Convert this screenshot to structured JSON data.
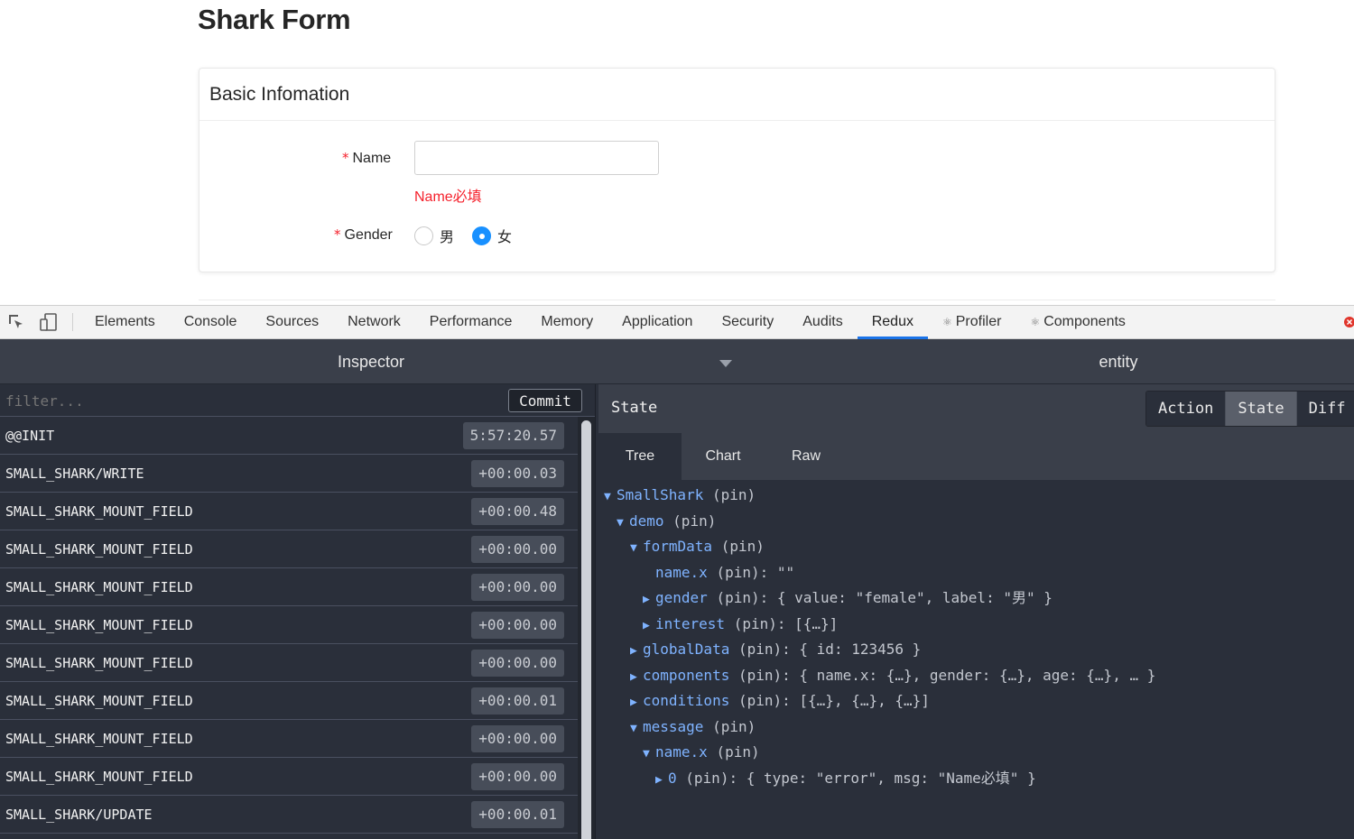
{
  "page": {
    "title": "Shark Form",
    "card_title": "Basic Infomation",
    "name_label": "Name",
    "name_value": "",
    "name_error": "Name必填",
    "gender_label": "Gender",
    "required_mark": "*",
    "gender_options": [
      "男",
      "女"
    ],
    "gender_selected": "女"
  },
  "devtools": {
    "tabs": [
      "Elements",
      "Console",
      "Sources",
      "Network",
      "Performance",
      "Memory",
      "Application",
      "Security",
      "Audits",
      "Redux",
      "Profiler",
      "Components"
    ],
    "active_tab": "Redux",
    "accent_color": "#1a73e8"
  },
  "redux": {
    "inspector_title": "Inspector",
    "entity_title": "entity",
    "filter_placeholder": "filter...",
    "commit_label": "Commit",
    "actions": [
      {
        "name": "@@INIT",
        "time": "5:57:20.57"
      },
      {
        "name": "SMALL_SHARK/WRITE",
        "time": "+00:00.03"
      },
      {
        "name": "SMALL_SHARK_MOUNT_FIELD",
        "time": "+00:00.48"
      },
      {
        "name": "SMALL_SHARK_MOUNT_FIELD",
        "time": "+00:00.00"
      },
      {
        "name": "SMALL_SHARK_MOUNT_FIELD",
        "time": "+00:00.00"
      },
      {
        "name": "SMALL_SHARK_MOUNT_FIELD",
        "time": "+00:00.00"
      },
      {
        "name": "SMALL_SHARK_MOUNT_FIELD",
        "time": "+00:00.00"
      },
      {
        "name": "SMALL_SHARK_MOUNT_FIELD",
        "time": "+00:00.01"
      },
      {
        "name": "SMALL_SHARK_MOUNT_FIELD",
        "time": "+00:00.00"
      },
      {
        "name": "SMALL_SHARK_MOUNT_FIELD",
        "time": "+00:00.00"
      },
      {
        "name": "SMALL_SHARK/UPDATE",
        "time": "+00:00.01"
      }
    ],
    "state_label": "State",
    "modes": [
      "Action",
      "State",
      "Diff"
    ],
    "active_mode": "State",
    "subtabs": [
      "Tree",
      "Chart",
      "Raw"
    ],
    "active_subtab": "Tree",
    "tree": [
      {
        "arrow": "▼",
        "key": "SmallShark",
        "pin": "(pin)",
        "value": ""
      },
      {
        "arrow": "▼",
        "key": "demo",
        "pin": "(pin)",
        "value": ""
      },
      {
        "arrow": "▼",
        "key": "formData",
        "pin": "(pin)",
        "value": ""
      },
      {
        "arrow": "",
        "key": "name.x",
        "pin": "(pin):",
        "value": "\"\""
      },
      {
        "arrow": "▶",
        "key": "gender",
        "pin": "(pin):",
        "value": "{ value: \"female\", label: \"男\" }"
      },
      {
        "arrow": "▶",
        "key": "interest",
        "pin": "(pin):",
        "value": "[{…}]"
      },
      {
        "arrow": "▶",
        "key": "globalData",
        "pin": "(pin):",
        "value": "{ id: 123456 }"
      },
      {
        "arrow": "▶",
        "key": "components",
        "pin": "(pin):",
        "value": "{ name.x: {…}, gender: {…}, age: {…}, … }"
      },
      {
        "arrow": "▶",
        "key": "conditions",
        "pin": "(pin):",
        "value": "[{…}, {…}, {…}]"
      },
      {
        "arrow": "▼",
        "key": "message",
        "pin": "(pin)",
        "value": ""
      },
      {
        "arrow": "▼",
        "key": "name.x",
        "pin": "(pin)",
        "value": ""
      },
      {
        "arrow": "▶",
        "key": "0",
        "pin": "(pin):",
        "value": "{ type: \"error\", msg: \"Name必填\" }"
      }
    ]
  }
}
